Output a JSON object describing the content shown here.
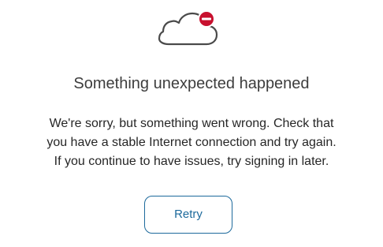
{
  "error": {
    "icon": "cloud-error-icon",
    "icon_colors": {
      "cloud_stroke": "#4a4a4a",
      "badge_fill": "#c8102e",
      "badge_mark": "#ffffff"
    },
    "title": "Something unexpected happened",
    "message_lines": [
      "We're sorry, but something went wrong. Check that",
      "you have a stable Internet connection and try again.",
      "If you continue to have issues, try signing in later."
    ]
  },
  "actions": {
    "retry_label": "Retry",
    "accent_color": "#1d6a9c"
  }
}
